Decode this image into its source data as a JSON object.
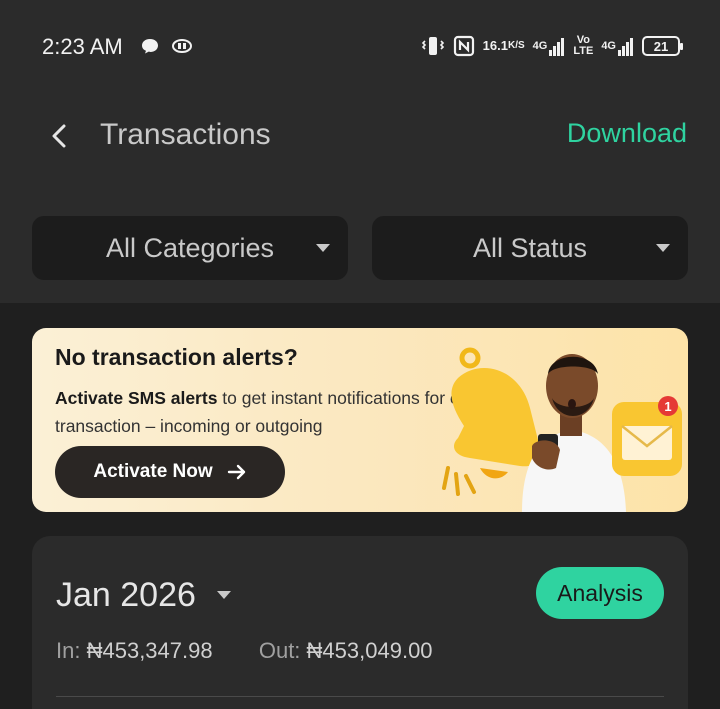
{
  "status_bar": {
    "time": "2:23 AM",
    "speed_value": "16.1",
    "speed_unit": "K/S",
    "net1": "4G",
    "net2_top": "Vo",
    "net2_bottom": "LTE",
    "net3": "4G",
    "battery": "21"
  },
  "header": {
    "title": "Transactions",
    "download_label": "Download"
  },
  "filters": {
    "category": "All Categories",
    "status": "All Status"
  },
  "banner": {
    "title": "No transaction alerts?",
    "text_bold": "Activate SMS alerts",
    "text_rest": " to get instant notifications for every transaction – incoming or outgoing",
    "button_label": "Activate Now",
    "notification_count": "1"
  },
  "month_summary": {
    "month": "Jan 2026",
    "analysis_label": "Analysis",
    "in_label": "In:",
    "in_value": "₦453,347.98",
    "out_label": "Out:",
    "out_value": "₦453,049.00"
  },
  "colors": {
    "accent": "#2fd3a0",
    "background": "#1f1f1f",
    "surface": "#2b2b2b"
  }
}
